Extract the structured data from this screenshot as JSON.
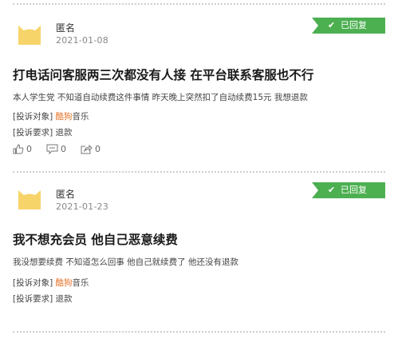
{
  "posts": [
    {
      "username": "匿名",
      "date": "2021-01-08",
      "badge": "已回复",
      "title": "打电话问客服两三次都没有人接 在平台联系客服也不行",
      "description": "本人学生党 不知道自动续费这件事情 昨天晚上突然扣了自动续费15元 我想退款",
      "complaint_target_label": "[投诉对象]",
      "complaint_target_highlight": "酷狗",
      "complaint_target_rest": "音乐",
      "complaint_request_label": "[投诉要求]",
      "complaint_request_value": "退款",
      "likes": "0",
      "comments": "0",
      "shares": "0"
    },
    {
      "username": "匿名",
      "date": "2021-01-23",
      "badge": "已回复",
      "title": "我不想充会员 他自己恶意续费",
      "description": "我没想要续费 不知道怎么回事 他自己就续费了 他还没有退款",
      "complaint_target_label": "[投诉对象]",
      "complaint_target_highlight": "酷狗",
      "complaint_target_rest": "音乐",
      "complaint_request_label": "[投诉要求]",
      "complaint_request_value": "退款"
    }
  ],
  "icons": {
    "avatar": "cat-avatar-icon",
    "badge": "check-icon",
    "like": "thumbs-up-icon",
    "comment": "comment-icon",
    "share": "share-icon"
  },
  "colors": {
    "badge_green": "#4caf50",
    "highlight_orange": "#e8742a",
    "avatar_yellow": "#f7d46a"
  }
}
